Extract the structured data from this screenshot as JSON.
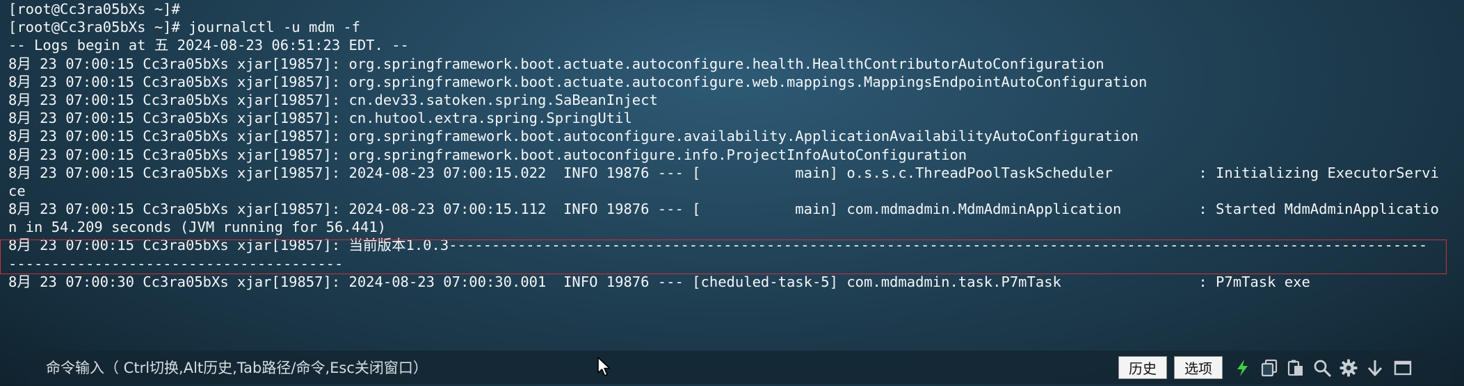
{
  "terminal": {
    "lines": [
      "[root@Cc3ra05bXs ~]#",
      "[root@Cc3ra05bXs ~]# journalctl -u mdm -f",
      "-- Logs begin at 五 2024-08-23 06:51:23 EDT. --",
      "8月 23 07:00:15 Cc3ra05bXs xjar[19857]: org.springframework.boot.actuate.autoconfigure.health.HealthContributorAutoConfiguration",
      "8月 23 07:00:15 Cc3ra05bXs xjar[19857]: org.springframework.boot.actuate.autoconfigure.web.mappings.MappingsEndpointAutoConfiguration",
      "8月 23 07:00:15 Cc3ra05bXs xjar[19857]: cn.dev33.satoken.spring.SaBeanInject",
      "8月 23 07:00:15 Cc3ra05bXs xjar[19857]: cn.hutool.extra.spring.SpringUtil",
      "8月 23 07:00:15 Cc3ra05bXs xjar[19857]: org.springframework.boot.autoconfigure.availability.ApplicationAvailabilityAutoConfiguration",
      "8月 23 07:00:15 Cc3ra05bXs xjar[19857]: org.springframework.boot.autoconfigure.info.ProjectInfoAutoConfiguration",
      "8月 23 07:00:15 Cc3ra05bXs xjar[19857]: 2024-08-23 07:00:15.022  INFO 19876 --- [           main] o.s.s.c.ThreadPoolTaskScheduler          : Initializing ExecutorServi",
      "ce",
      "8月 23 07:00:15 Cc3ra05bXs xjar[19857]: 2024-08-23 07:00:15.112  INFO 19876 --- [           main] com.mdmadmin.MdmAdminApplication         : Started MdmAdminApplicatio",
      "n in 54.209 seconds (JVM running for 56.441)",
      "8月 23 07:00:15 Cc3ra05bXs xjar[19857]: 当前版本1.0.3------------------------------------------------------------------------------------------------------------------",
      "---------------------------------------",
      "8月 23 07:00:30 Cc3ra05bXs xjar[19857]: 2024-08-23 07:00:30.001  INFO 19876 --- [cheduled-task-5] com.mdmadmin.task.P7mTask                : P7mTask exe"
    ]
  },
  "command_bar": {
    "placeholder": "命令输入（ Ctrl切换,Alt历史,Tab路径/命令,Esc关闭窗口）",
    "history_label": "历史",
    "options_label": "选项"
  },
  "icons": {
    "lightning": "lightning-icon",
    "copy": "copy-icon",
    "paste": "paste-icon",
    "search": "search-icon",
    "settings": "gear-icon",
    "download": "arrow-down-icon",
    "window": "window-icon"
  },
  "colors": {
    "highlight_border": "#d0303a",
    "lightning": "#3fd13f"
  }
}
